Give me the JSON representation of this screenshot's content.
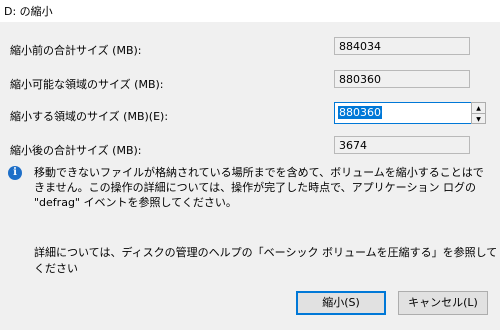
{
  "window": {
    "title": "D: の縮小"
  },
  "fields": {
    "total_before_label": "縮小前の合計サイズ (MB):",
    "total_before_value": "884034",
    "available_label": "縮小可能な領域のサイズ (MB):",
    "available_value": "880360",
    "shrink_label": "縮小する領域のサイズ (MB)(E):",
    "shrink_value": "880360",
    "total_after_label": "縮小後の合計サイズ (MB):",
    "total_after_value": "3674"
  },
  "info": {
    "icon": "info-icon",
    "text": "移動できないファイルが格納されている場所までを含めて、ボリュームを縮小することはできません。この操作の詳細については、操作が完了した時点で、アプリケーション ログの \"defrag\" イベントを参照してください。"
  },
  "help_text": "詳細については、ディスクの管理のヘルプの「ベーシック ボリュームを圧縮する」を参照してください",
  "buttons": {
    "shrink": "縮小(S)",
    "cancel": "キャンセル(L)"
  },
  "colors": {
    "accent": "#0078d7",
    "info_icon": "#1e6fc8"
  }
}
